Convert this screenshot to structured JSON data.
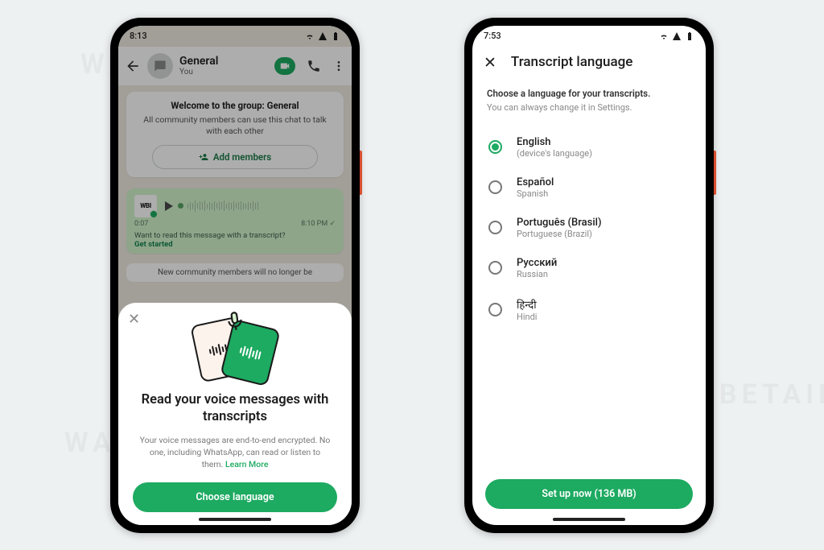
{
  "phone1": {
    "status_time": "8:13",
    "header": {
      "name": "General",
      "sub": "You"
    },
    "welcome": {
      "title": "Welcome to the group: General",
      "body": "All community members can use this chat to talk with each other",
      "add_members": "Add members"
    },
    "voice": {
      "avatar_text": "WBI",
      "duration": "0:07",
      "time": "8:10 PM",
      "hint": "Want to read this message with a transcript?",
      "hint_link": "Get started"
    },
    "sys_note": "New community members will no longer be",
    "sheet": {
      "title": "Read your voice messages with transcripts",
      "desc": "Your voice messages are end-to-end encrypted. No one, including WhatsApp, can read or listen to them. ",
      "learn": "Learn More",
      "cta": "Choose language"
    }
  },
  "phone2": {
    "status_time": "7:53",
    "title": "Transcript language",
    "lead1": "Choose a language for your transcripts.",
    "lead2": "You can always change it in Settings.",
    "languages": [
      {
        "native": "English",
        "en": "(device's language)",
        "selected": true
      },
      {
        "native": "Español",
        "en": "Spanish",
        "selected": false
      },
      {
        "native": "Português (Brasil)",
        "en": "Portuguese (Brazil)",
        "selected": false
      },
      {
        "native": "Русский",
        "en": "Russian",
        "selected": false
      },
      {
        "native": "हिन्दी",
        "en": "Hindi",
        "selected": false
      }
    ],
    "cta": "Set up now (136 MB)"
  }
}
